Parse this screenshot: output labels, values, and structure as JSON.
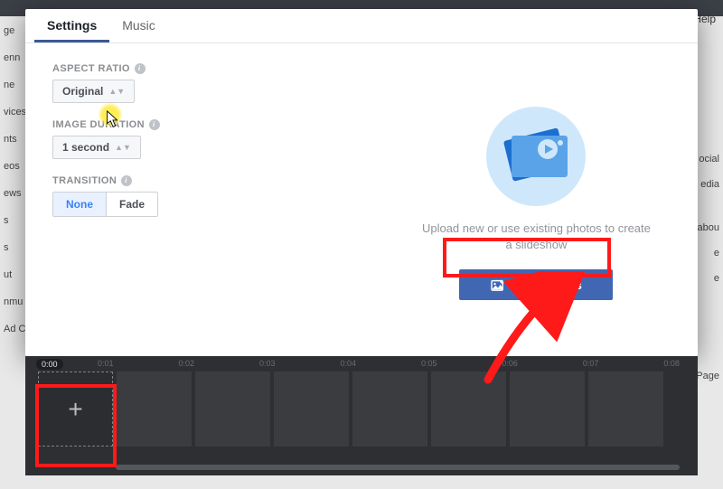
{
  "tabs": {
    "settings": "Settings",
    "music": "Music"
  },
  "aspect": {
    "label": "ASPECT RATIO",
    "value": "Original"
  },
  "duration": {
    "label": "IMAGE DURATION",
    "value": "1 second"
  },
  "transition": {
    "label": "TRANSITION",
    "none": "None",
    "fade": "Fade"
  },
  "promo": "Upload new or use existing photos to create a slideshow",
  "addPhotosLabel": "Add Photos",
  "timeline": {
    "start": "0:00",
    "ticks": [
      "0:01",
      "0:02",
      "0:03",
      "0:04",
      "0:05",
      "0:06",
      "0:07",
      "0:08"
    ]
  },
  "bg": {
    "help": "Help",
    "leftItems": [
      "ge",
      "enn",
      "ne",
      "vices",
      "nts",
      "eos",
      "ews",
      "s",
      "s",
      "ut",
      "nmu",
      "Ad C"
    ],
    "rightItems": [
      "ocial",
      "edia",
      "abou",
      "e",
      "e",
      "",
      "Page"
    ]
  }
}
